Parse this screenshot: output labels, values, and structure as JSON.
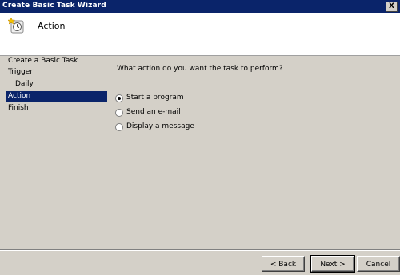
{
  "window": {
    "title": "Create Basic Task Wizard",
    "close_glyph": "X"
  },
  "header": {
    "title": "Action",
    "icon": "task-scheduler-icon"
  },
  "sidebar": {
    "items": [
      {
        "label": "Create a Basic Task"
      },
      {
        "label": "Trigger"
      },
      {
        "label": "Daily"
      },
      {
        "label": "Action"
      },
      {
        "label": "Finish"
      }
    ]
  },
  "main": {
    "question": "What action do you want the task to perform?",
    "options": [
      {
        "label": "Start a program",
        "selected": true
      },
      {
        "label": "Send an e-mail",
        "selected": false
      },
      {
        "label": "Display a message",
        "selected": false
      }
    ]
  },
  "buttons": {
    "back": "< Back",
    "next": "Next >",
    "cancel": "Cancel"
  },
  "colors": {
    "titlebar": "#0a246a",
    "selection": "#0a246a",
    "background": "#d4d0c8"
  }
}
